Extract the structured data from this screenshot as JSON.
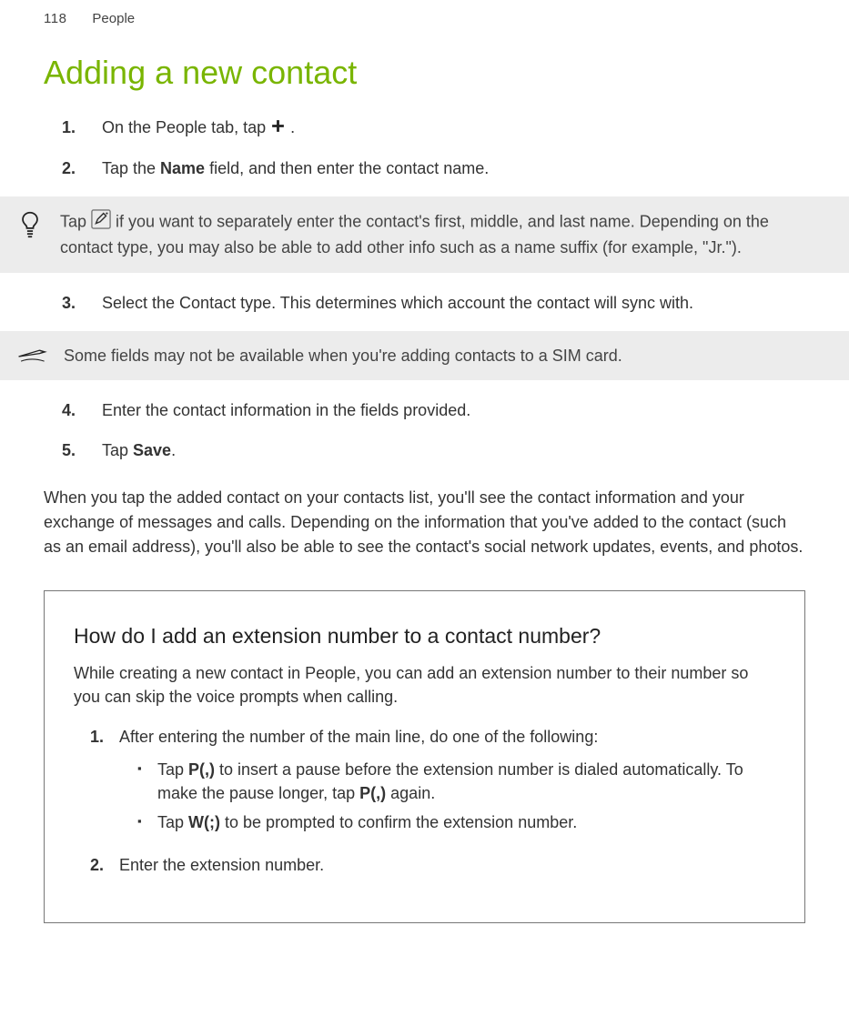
{
  "header": {
    "page_number": "118",
    "section": "People"
  },
  "title": "Adding a new contact",
  "steps": {
    "s1a": "On the People tab, tap ",
    "s1b": ".",
    "s2a": "Tap the ",
    "s2b": "Name",
    "s2c": " field, and then enter the contact name.",
    "s3": "Select the Contact type. This determines which account the contact will sync with.",
    "s4": "Enter the contact information in the fields provided.",
    "s5a": "Tap ",
    "s5b": "Save",
    "s5c": "."
  },
  "tip": {
    "a": "Tap ",
    "b": " if you want to separately enter the contact's first, middle, and last name. Depending on the contact type, you may also be able to add other info such as a name suffix (for example, \"Jr.\")."
  },
  "note": "Some fields may not be available when you're adding contacts to a SIM card.",
  "after": "When you tap the added contact on your contacts list, you'll see the contact information and your exchange of messages and calls. Depending on the information that you've added to the contact (such as an email address), you'll also be able to see the contact's social network updates, events, and photos.",
  "faq": {
    "title": "How do I add an extension number to a contact number?",
    "intro": "While creating a new contact in People, you can add an extension number to their number so you can skip the voice prompts when calling.",
    "step1": "After entering the number of the main line, do one of the following:",
    "b1a": "Tap ",
    "b1b": "P(,)",
    "b1c": " to insert a pause before the extension number is dialed automatically. To make the pause longer, tap ",
    "b1d": "P(,)",
    "b1e": " again.",
    "b2a": "Tap ",
    "b2b": "W(;)",
    "b2c": " to be prompted to confirm the extension number.",
    "step2": "Enter the extension number."
  }
}
